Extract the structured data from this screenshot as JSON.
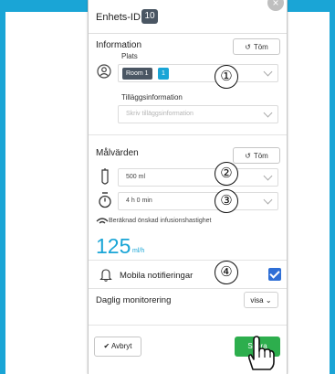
{
  "header": {
    "title": "Enhets-ID",
    "id_value": "10",
    "close_label": "×"
  },
  "information": {
    "title": "Information",
    "clear_label": "Töm",
    "plats_label": "Plats",
    "room_chip": "Room 1",
    "room_number": "1",
    "extra_label": "Tilläggsinformation",
    "extra_placeholder": "Skriv tilläggsinformation"
  },
  "targets": {
    "title": "Målvärden",
    "clear_label": "Töm",
    "volume_value": "500 ml",
    "duration_value": "4 h 0 min",
    "rate_label": "Beräknad önskad infusionshastighet",
    "rate_value": "125",
    "rate_unit": "ml/h"
  },
  "notifications": {
    "label": "Mobila notifieringar",
    "checked": true
  },
  "monitoring": {
    "label": "Daglig monitorering",
    "dropdown_value": "visa"
  },
  "footer": {
    "cancel_label": "Avbryt",
    "save_label": "Spara"
  },
  "annotations": [
    "①",
    "②",
    "③",
    "④"
  ],
  "colors": {
    "accent": "#1aa5d6",
    "save": "#2dae4d",
    "checkbox": "#2f6fd6",
    "badge": "#4a5663"
  }
}
